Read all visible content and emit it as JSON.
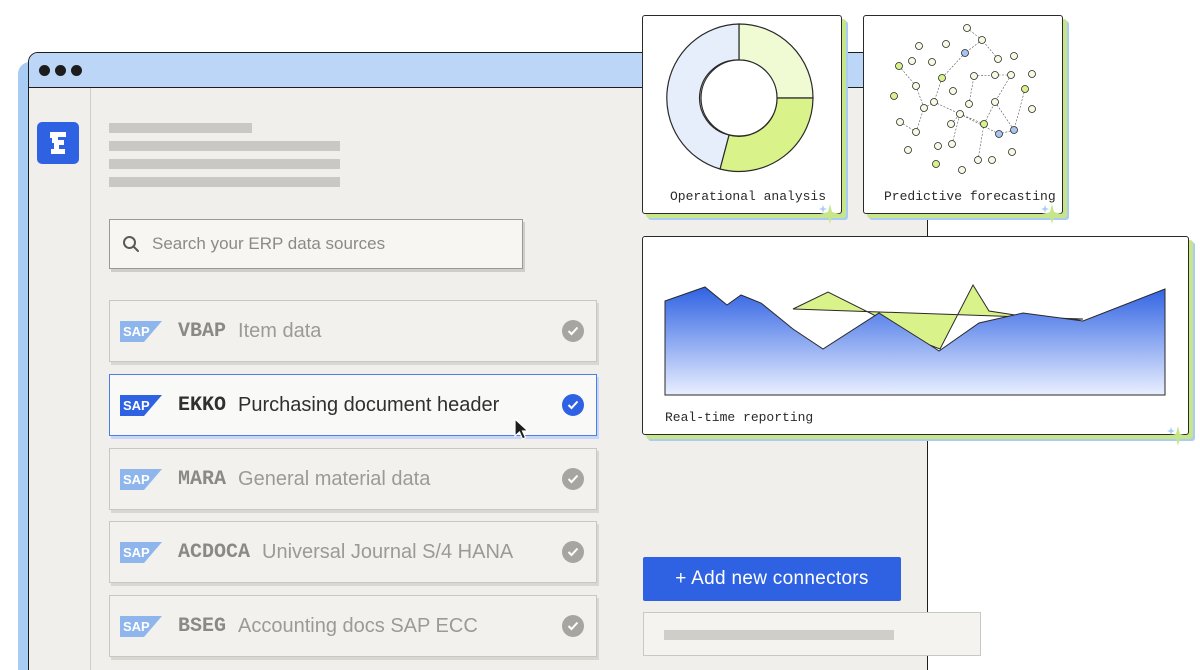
{
  "search": {
    "placeholder": "Search your ERP data sources"
  },
  "sources": [
    {
      "logo": "SAP",
      "code": "VBAP",
      "description": "Item data",
      "selected": false
    },
    {
      "logo": "SAP",
      "code": "EKKO",
      "description": "Purchasing document header",
      "selected": true
    },
    {
      "logo": "SAP",
      "code": "MARA",
      "description": "General material data",
      "selected": false
    },
    {
      "logo": "SAP",
      "code": "ACDOCA",
      "description": "Universal Journal S/4 HANA",
      "selected": false
    },
    {
      "logo": "SAP",
      "code": "BSEG",
      "description": "Accounting docs SAP ECC",
      "selected": false
    }
  ],
  "cards": {
    "operational": {
      "label": "Operational analysis"
    },
    "predictive": {
      "label": "Predictive forecasting"
    },
    "realtime": {
      "label": "Real-time reporting"
    }
  },
  "add_connectors": {
    "label": "+ Add new connectors"
  },
  "colors": {
    "accent": "#2f62e3",
    "lime": "#d9f28a",
    "light_blue": "#bcd6f7"
  }
}
